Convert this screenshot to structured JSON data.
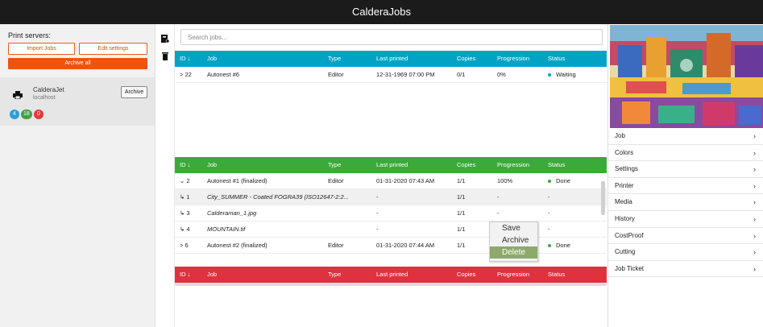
{
  "app": {
    "title": "CalderaJobs"
  },
  "left": {
    "print_servers_label": "Print servers:",
    "import_jobs": "Import Jobs",
    "edit_settings": "Edit settings",
    "archive_all": "Archive all",
    "printer": {
      "name": "CalderaJet",
      "host": "localhost",
      "archive_button": "Archive",
      "badges": [
        {
          "value": "4",
          "color": "#2a9fd6"
        },
        {
          "value": "18",
          "color": "#43a047"
        },
        {
          "value": "0",
          "color": "#e53935"
        }
      ]
    }
  },
  "search": {
    "placeholder": "Search jobs..."
  },
  "columns": {
    "id": "ID ↓",
    "job": "Job",
    "type": "Type",
    "last": "Last printed",
    "copies": "Copies",
    "progression": "Progression",
    "status": "Status"
  },
  "queue": {
    "color": "#00a3c4",
    "rows": [
      {
        "id": "> 22",
        "job": "Autonest #6",
        "type": "Editor",
        "last": "12-31-1969 07:00 PM",
        "copies": "0/1",
        "prog": "0%",
        "status": "Waiting",
        "dot": "#00a3c4"
      }
    ]
  },
  "done": {
    "color": "#3aaa3a",
    "rows": [
      {
        "id": "⌄ 2",
        "job": "Autonest #1 (finalized)",
        "type": "Editor",
        "last": "01-31-2020 07:43 AM",
        "copies": "1/1",
        "prog": "100%",
        "status": "Done",
        "dot": "#3aaa3a",
        "italic": false
      },
      {
        "id": "↳ 1",
        "job": "City_SUMMER - Coated FOGRA39 (ISO12647-2:2...",
        "type": "",
        "last": "-",
        "copies": "1/1",
        "prog": "-",
        "status": "-",
        "italic": true
      },
      {
        "id": "↳ 3",
        "job": "Calderaman_1.jpg",
        "type": "",
        "last": "-",
        "copies": "1/1",
        "prog": "-",
        "status": "-",
        "italic": true
      },
      {
        "id": "↳ 4",
        "job": "MOUNTAIN.tif",
        "type": "",
        "last": "-",
        "copies": "1/1",
        "prog": "-",
        "status": "-",
        "italic": true
      },
      {
        "id": "> 6",
        "job": "Autonest #2 (finalized)",
        "type": "Editor",
        "last": "01-31-2020 07:44 AM",
        "copies": "1/1",
        "prog": "100%",
        "status": "Done",
        "dot": "#3aaa3a",
        "italic": false
      }
    ]
  },
  "error": {
    "color": "#e0313f"
  },
  "context_menu": {
    "items": [
      "Save",
      "Archive",
      "Delete"
    ],
    "highlighted": "Delete"
  },
  "right_menu": [
    "Job",
    "Colors",
    "Settings",
    "Printer",
    "Media",
    "History",
    "CostProof",
    "Cutting",
    "Job Ticket"
  ]
}
